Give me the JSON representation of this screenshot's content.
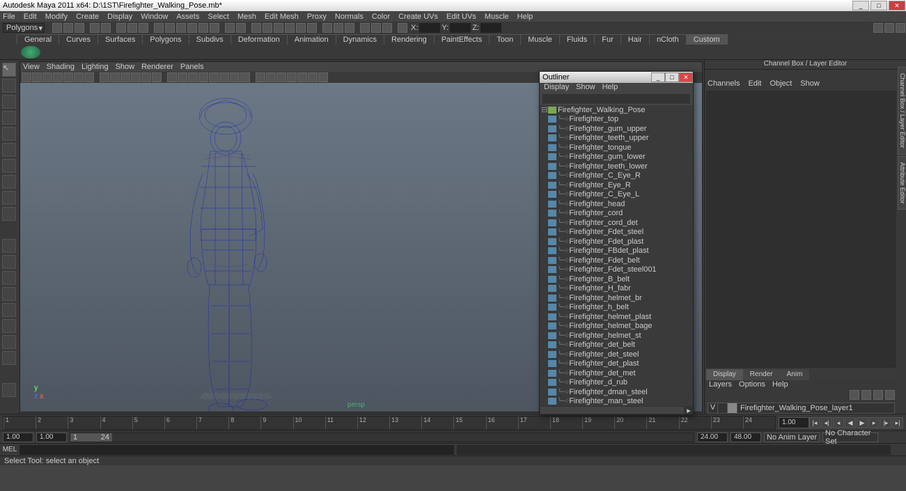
{
  "title": "Autodesk Maya 2011 x64: D:\\1ST\\Firefighter_Walking_Pose.mb*",
  "menu": [
    "File",
    "Edit",
    "Modify",
    "Create",
    "Display",
    "Window",
    "Assets",
    "Select",
    "Mesh",
    "Edit Mesh",
    "Proxy",
    "Normals",
    "Color",
    "Create UVs",
    "Edit UVs",
    "Muscle",
    "Help"
  ],
  "mode": "Polygons",
  "coord_labels": {
    "x": "X:",
    "y": "Y:",
    "z": "Z:"
  },
  "shelf_tabs": [
    "General",
    "Curves",
    "Surfaces",
    "Polygons",
    "Subdivs",
    "Deformation",
    "Animation",
    "Dynamics",
    "Rendering",
    "PaintEffects",
    "Toon",
    "Muscle",
    "Fluids",
    "Fur",
    "Hair",
    "nCloth",
    "Custom"
  ],
  "shelf_active": "Custom",
  "view_menu": [
    "View",
    "Shading",
    "Lighting",
    "Show",
    "Renderer",
    "Panels"
  ],
  "persp_label": "persp",
  "outliner": {
    "title": "Outliner",
    "menu": [
      "Display",
      "Show",
      "Help"
    ],
    "root": "Firefighter_Walking_Pose",
    "items": [
      "Firefighter_top",
      "Firefighter_gum_upper",
      "Firefighter_teeth_upper",
      "Firefighter_tongue",
      "Firefighter_gum_lower",
      "Firefighter_teeth_lower",
      "Firefighter_C_Eye_R",
      "Firefighter_Eye_R",
      "Firefighter_C_Eye_L",
      "Firefighter_head",
      "Firefighter_cord",
      "Firefighter_cord_det",
      "Firefighter_Fdet_steel",
      "Firefighter_Fdet_plast",
      "Firefighter_FBdet_plast",
      "Firefighter_Fdet_belt",
      "Firefighter_Fdet_steel001",
      "Firefighter_B_belt",
      "Firefighter_H_fabr",
      "Firefighter_helmet_br",
      "Firefighter_h_belt",
      "Firefighter_helmet_plast",
      "Firefighter_helmet_bage",
      "Firefighter_helmet_st",
      "Firefighter_det_belt",
      "Firefighter_det_steel",
      "Firefighter_det_plast",
      "Firefighter_det_met",
      "Firefighter_d_rub",
      "Firefighter_dman_steel",
      "Firefighter_man_steel"
    ]
  },
  "channelbox": {
    "title": "Channel Box / Layer Editor",
    "menu": [
      "Channels",
      "Edit",
      "Object",
      "Show"
    ],
    "layer_tabs": [
      "Display",
      "Render",
      "Anim"
    ],
    "layer_menu": [
      "Layers",
      "Options",
      "Help"
    ],
    "layer_vis": "V",
    "layer_name": "Firefighter_Walking_Pose_layer1"
  },
  "side_tabs": [
    "Channel Box / Layer Editor",
    "Attribute Editor"
  ],
  "timeline": {
    "start": 1,
    "end": 24,
    "ticks": [
      "1",
      "2",
      "3",
      "4",
      "5",
      "6",
      "7",
      "8",
      "9",
      "10",
      "11",
      "12",
      "13",
      "14",
      "15",
      "16",
      "17",
      "18",
      "19",
      "20",
      "21",
      "22",
      "23",
      "24"
    ],
    "cur": "1.00"
  },
  "range": {
    "a": "1.00",
    "b": "1.00",
    "c": "1",
    "d": "24",
    "e": "24.00",
    "f": "48.00",
    "anim": "No Anim Layer",
    "char": "No Character Set"
  },
  "cmd_label": "MEL",
  "help_text": "Select Tool: select an object"
}
